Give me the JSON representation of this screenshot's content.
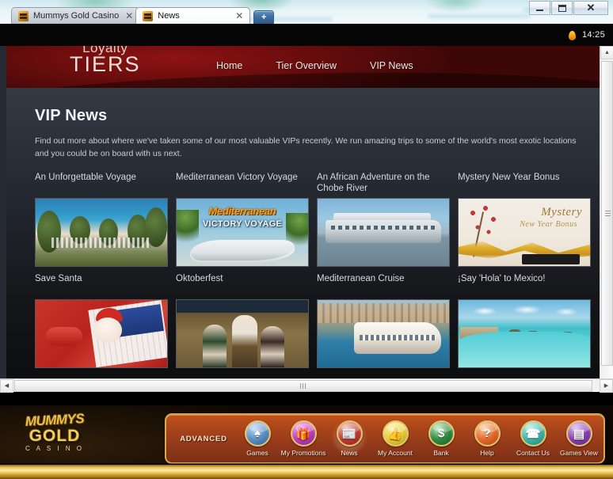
{
  "window": {
    "minimize_label": "minimize",
    "maximize_label": "maximize",
    "close_label": "✕",
    "clock": "14:25"
  },
  "browser": {
    "tabs": [
      {
        "title": "Mummys Gold Casino",
        "close": "✕",
        "active": false
      },
      {
        "title": "News",
        "close": "✕",
        "active": true
      }
    ],
    "new_tab_label": "+"
  },
  "site": {
    "logo_line1": "Loyalty",
    "logo_line2": "TIERS",
    "nav": [
      {
        "label": "Home"
      },
      {
        "label": "Tier Overview"
      },
      {
        "label": "VIP News"
      }
    ]
  },
  "page": {
    "title": "VIP News",
    "intro": "Find out more about where we've taken some of our most valuable VIPs recently. We run amazing trips to some of the world's most exotic locations and you could be on board with us next.",
    "articles": [
      {
        "title": "An Unforgettable Voyage",
        "art": "th-beach"
      },
      {
        "title": "Mediterranean Victory Voyage",
        "art": "th-med",
        "banner_title": "Mediterranean",
        "banner_sub": "VICTORY VOYAGE"
      },
      {
        "title": "An African Adventure on the Chobe River",
        "art": "th-boat"
      },
      {
        "title": "Mystery New Year Bonus",
        "art": "th-mystery",
        "banner_title": "Mystery",
        "banner_sub": "New Year Bonus"
      },
      {
        "title": "Save Santa",
        "art": "th-santa"
      },
      {
        "title": "Oktoberfest",
        "art": "th-okto"
      },
      {
        "title": "Mediterranean Cruise",
        "art": "th-cruise"
      },
      {
        "title": "¡Say 'Hola' to Mexico!",
        "art": "th-mexico"
      }
    ]
  },
  "casino": {
    "logo_line1": "MUMMYS",
    "logo_line2": "GOLD",
    "logo_line3": "C A S I N O",
    "advanced_label": "ADVANCED",
    "toolbar": [
      {
        "label": "Games",
        "icon": "cards-icon",
        "glyph": "♠",
        "cls": "ic-games",
        "active": false
      },
      {
        "label": "My Promotions",
        "icon": "gift-icon",
        "glyph": "🎁",
        "cls": "ic-promo",
        "active": false
      },
      {
        "label": "News",
        "icon": "newspaper-icon",
        "glyph": "📰",
        "cls": "ic-news",
        "active": true
      },
      {
        "label": "My Account",
        "icon": "thumbs-up-icon",
        "glyph": "👍",
        "cls": "ic-account",
        "active": false
      },
      {
        "label": "Bank",
        "icon": "dollar-icon",
        "glyph": "$",
        "cls": "ic-bank",
        "active": false
      },
      {
        "label": "Help",
        "icon": "question-icon",
        "glyph": "?",
        "cls": "ic-help",
        "active": false
      },
      {
        "label": "Contact Us",
        "icon": "telephone-icon",
        "glyph": "☎",
        "cls": "ic-contact",
        "active": false
      },
      {
        "label": "Games View",
        "icon": "games-view-icon",
        "glyph": "▤",
        "cls": "ic-gview",
        "active": false
      }
    ]
  },
  "scrollbars": {
    "up_arrow": "▲",
    "down_arrow": "▼",
    "left_arrow": "◀",
    "right_arrow": "▶"
  },
  "colors": {
    "header_red": "#7c1111",
    "content_dark": "#20242b",
    "toolbar_orange": "#a8441a",
    "gold": "#e8c254"
  }
}
